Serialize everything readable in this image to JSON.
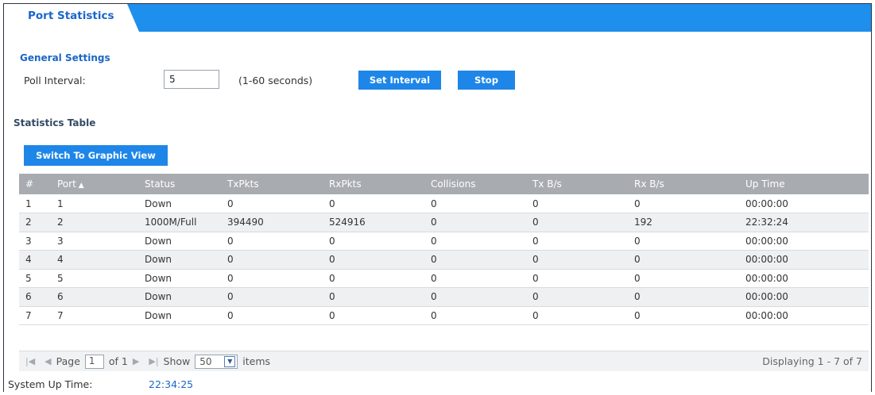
{
  "header": {
    "tab_title": "Port Statistics"
  },
  "general": {
    "title": "General Settings",
    "poll_label": "Poll Interval:",
    "poll_value": "5",
    "poll_hint": "(1-60 seconds)",
    "set_interval_label": "Set Interval",
    "stop_label": "Stop"
  },
  "stats": {
    "title": "Statistics Table",
    "switch_view_label": "Switch To Graphic View",
    "columns": [
      "#",
      "Port",
      "Status",
      "TxPkts",
      "RxPkts",
      "Collisions",
      "Tx B/s",
      "Rx B/s",
      "Up Time"
    ],
    "sort_indicator": "▲",
    "rows": [
      [
        "1",
        "1",
        "Down",
        "0",
        "0",
        "0",
        "0",
        "0",
        "00:00:00"
      ],
      [
        "2",
        "2",
        "1000M/Full",
        "394490",
        "524916",
        "0",
        "0",
        "192",
        "22:32:24"
      ],
      [
        "3",
        "3",
        "Down",
        "0",
        "0",
        "0",
        "0",
        "0",
        "00:00:00"
      ],
      [
        "4",
        "4",
        "Down",
        "0",
        "0",
        "0",
        "0",
        "0",
        "00:00:00"
      ],
      [
        "5",
        "5",
        "Down",
        "0",
        "0",
        "0",
        "0",
        "0",
        "00:00:00"
      ],
      [
        "6",
        "6",
        "Down",
        "0",
        "0",
        "0",
        "0",
        "0",
        "00:00:00"
      ],
      [
        "7",
        "7",
        "Down",
        "0",
        "0",
        "0",
        "0",
        "0",
        "00:00:00"
      ]
    ]
  },
  "pager": {
    "page_label": "Page",
    "page_value": "1",
    "of_label": "of 1",
    "show_label": "Show",
    "page_size": "50",
    "items_label": "items",
    "display_text": "Displaying 1 - 7 of 7"
  },
  "system": {
    "uptime_label": "System Up Time:",
    "uptime_value": "22:34:25"
  },
  "colors": {
    "accent": "#1e86e8",
    "header_bar": "#1e8fec",
    "table_header": "#a8acb1",
    "title_text": "#1a66c8"
  }
}
